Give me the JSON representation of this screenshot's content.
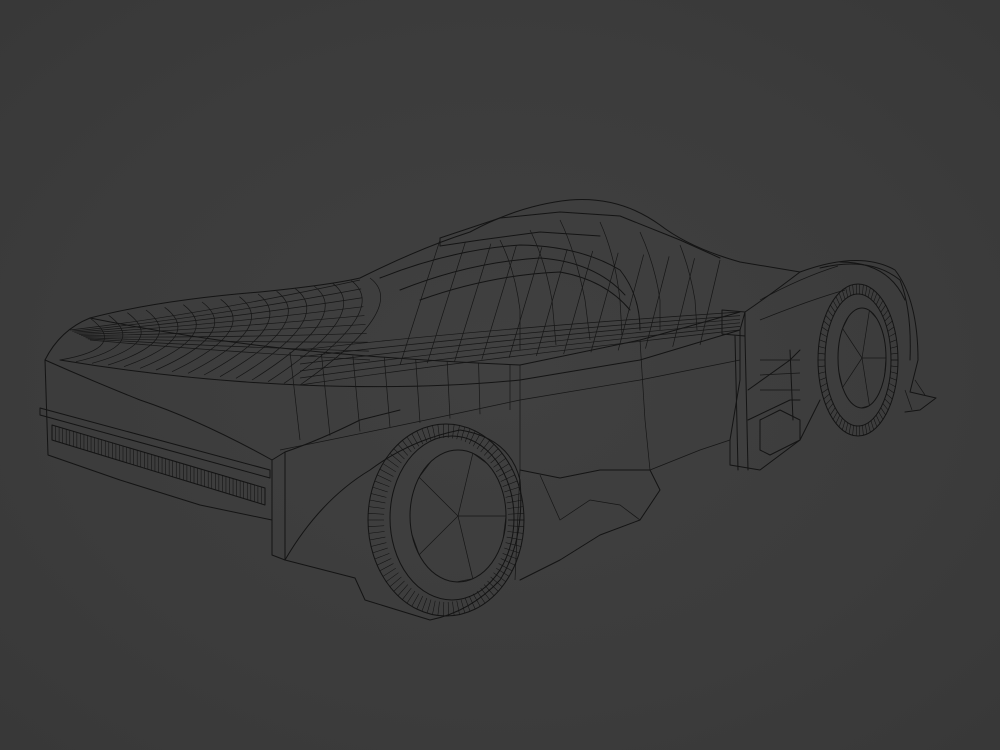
{
  "viewport": {
    "mode": "wireframe",
    "background_color": "#3d3d3d",
    "wire_color": "#141414"
  },
  "object": {
    "label": ""
  }
}
